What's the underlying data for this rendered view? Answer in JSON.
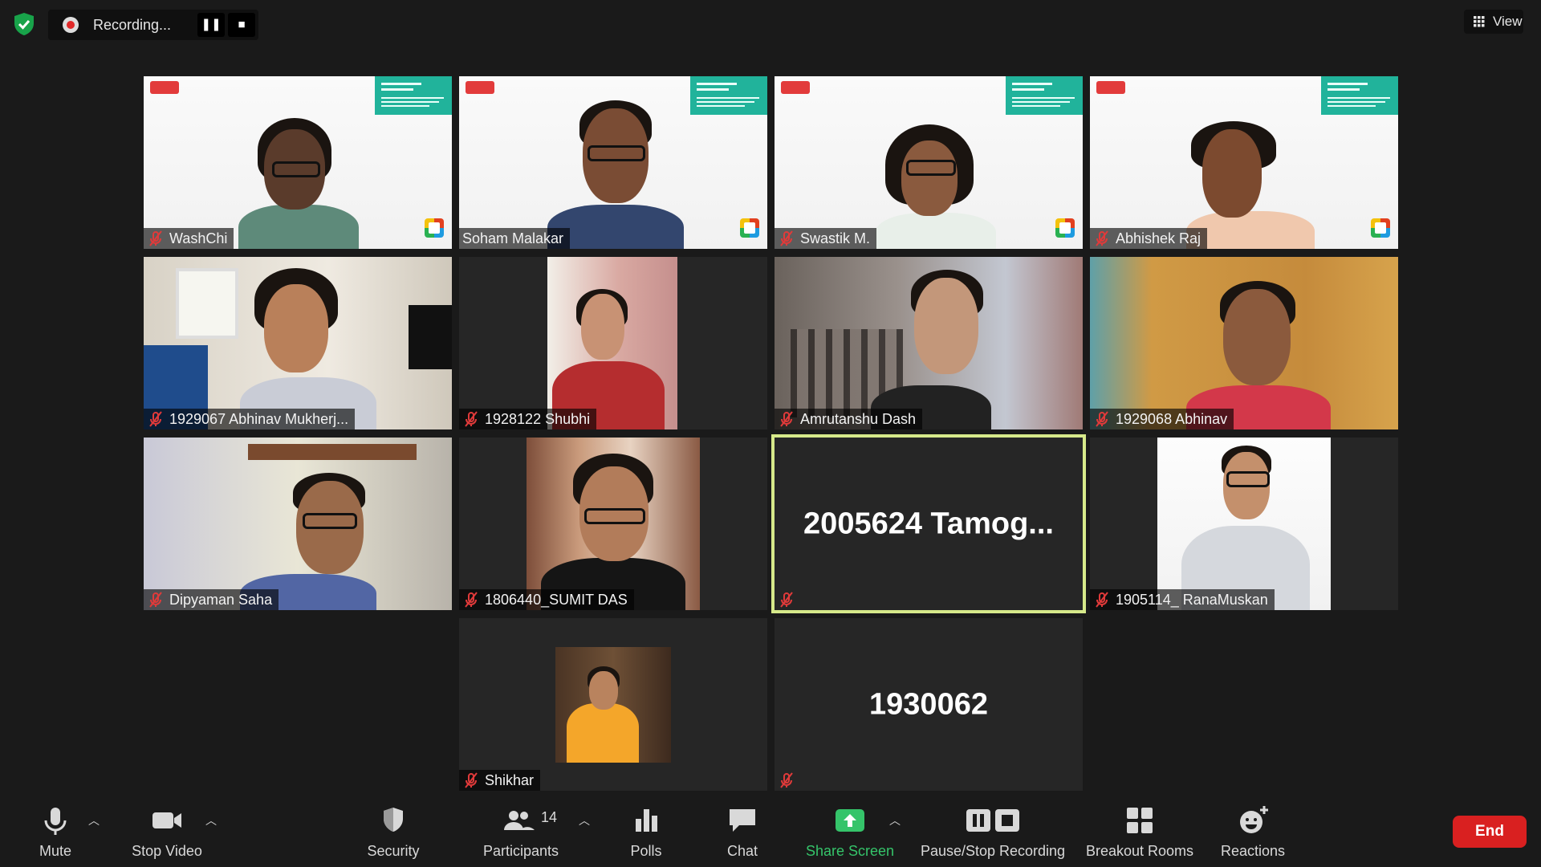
{
  "top_bar": {
    "recording_label": "Recording...",
    "pause_glyph": "❚❚",
    "stop_glyph": "■",
    "view_label": "View"
  },
  "tiles": [
    {
      "name": "WashChi",
      "video": true
    },
    {
      "name": "Soham Malakar",
      "video": true
    },
    {
      "name": "Swastik M.",
      "video": true
    },
    {
      "name": "Abhishek Raj",
      "video": true
    },
    {
      "name": "1929067 Abhinav Mukherj...",
      "video": true
    },
    {
      "name": "1928122 Shubhi",
      "video": true
    },
    {
      "name": "Amrutanshu Dash",
      "video": true
    },
    {
      "name": "1929068 Abhinav",
      "video": true
    },
    {
      "name": "Dipyaman Saha",
      "video": true
    },
    {
      "name": "1806440_SUMIT DAS",
      "video": true
    },
    {
      "name": "",
      "display_name": "2005624  Tamog...",
      "video": false,
      "active_speaker": true
    },
    {
      "name": "1905114_ RanaMuskan",
      "video": true
    },
    {
      "name": "Shikhar",
      "video": true
    },
    {
      "name": "",
      "display_name": "1930062",
      "video": false
    }
  ],
  "toolbar": {
    "mute": "Mute",
    "stop_video": "Stop Video",
    "security": "Security",
    "participants": "Participants",
    "participants_count": "14",
    "polls": "Polls",
    "chat": "Chat",
    "share_screen": "Share Screen",
    "pause_stop_recording": "Pause/Stop Recording",
    "breakout_rooms": "Breakout Rooms",
    "reactions": "Reactions",
    "end": "End"
  },
  "colors": {
    "background": "#1a1a1a",
    "tile": "#262626",
    "active_speaker_border": "#d6e98a",
    "share_green": "#35c46a",
    "end_red": "#d92020",
    "recording_red": "#e02828"
  }
}
